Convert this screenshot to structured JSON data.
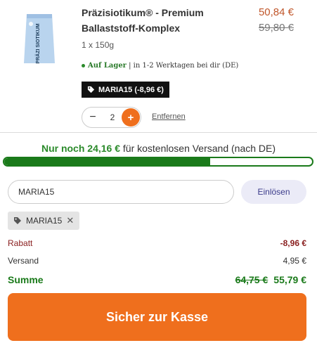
{
  "product": {
    "name": "Präzisiotikum® - Premium Ballaststoff-Komplex",
    "price_new": "50,84 €",
    "price_old": "59,80 €",
    "variant": "1 x 150g",
    "stock_label": "Auf Lager",
    "stock_detail": " | in 1-2 Werktagen bei dir (DE)",
    "promo_badge": "MARIA15 (-8,96 €)",
    "pack_label": "PRÄZI SIOTIKUM",
    "quantity": "2",
    "remove_label": "Entfernen"
  },
  "shipping": {
    "prefix": "Nur noch ",
    "amount": "24,16 €",
    "suffix": " für kostenlosen Versand (nach DE)",
    "progress_fraction": 0.67
  },
  "coupon": {
    "input_value": "MARIA15",
    "button_label": "Einlösen",
    "applied_code": "MARIA15"
  },
  "summary": {
    "discount_label": "Rabatt",
    "discount_value": "-8,96 €",
    "shipping_label": "Versand",
    "shipping_value": "4,95 €",
    "total_label": "Summe",
    "total_old": "64,75 €",
    "total_new": "55,79 €"
  },
  "checkout_label": "Sicher zur Kasse",
  "colors": {
    "accent": "#ef6f1d",
    "success": "#1a7a1a",
    "discount": "#8a2020"
  }
}
